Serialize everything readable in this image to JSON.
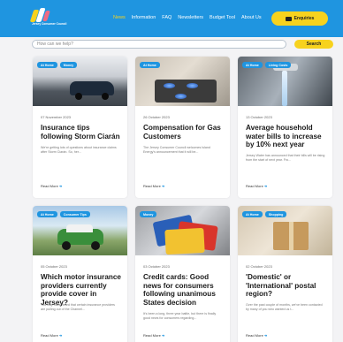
{
  "header": {
    "brand": "Jersey Consumer Council",
    "nav": [
      "News",
      "Information",
      "FAQ",
      "Newsletters",
      "Budget Tool",
      "About Us"
    ],
    "active_nav": "News",
    "enquiries_label": "Enquiries"
  },
  "search": {
    "placeholder": "How can we help?",
    "button_label": "Search"
  },
  "cards": [
    {
      "tags": [
        "At Home",
        "Money"
      ],
      "date": "07 November 2023",
      "title": "Insurance tips following Storm Ciarán",
      "excerpt": "We're getting lots of questions about insurance claims after Storm Ciarán. So, her...",
      "read_more": "Read More"
    },
    {
      "tags": [
        "At Home"
      ],
      "date": "26 October 2023",
      "title": "Compensation for Gas Customers",
      "excerpt": "The Jersey Consumer Council welcomes Island Energy's announcement that it will be...",
      "read_more": "Read More"
    },
    {
      "tags": [
        "At Home",
        "Living Costs"
      ],
      "date": "13 October 2023",
      "title": "Average household water bills to increase by 10% next year",
      "excerpt": "Jersey Water has announced that their bills will be rising from the start of next year. Fro...",
      "read_more": "Read More"
    },
    {
      "tags": [
        "At Home",
        "Consumer Tips"
      ],
      "date": "05 October 2023",
      "title": "Which motor insurance providers currently provide cover in Jersey?",
      "excerpt": "You may have heard that certain insurance providers are pulling out of the Channel...",
      "read_more": "Read More"
    },
    {
      "tags": [
        "Money"
      ],
      "date": "03 October 2023",
      "title": "Credit cards: Good news for consumers following unanimous States decision",
      "excerpt": "It's been a long, three year battle, but there is finally good news for consumers regarding...",
      "read_more": "Read More"
    },
    {
      "tags": [
        "At Home",
        "Shopping"
      ],
      "date": "02 October 2023",
      "title": "'Domestic' or 'International' postal region?",
      "excerpt": "Over the past couple of months, we've been contacted by many of you who wanted us t...",
      "read_more": "Read More"
    }
  ]
}
